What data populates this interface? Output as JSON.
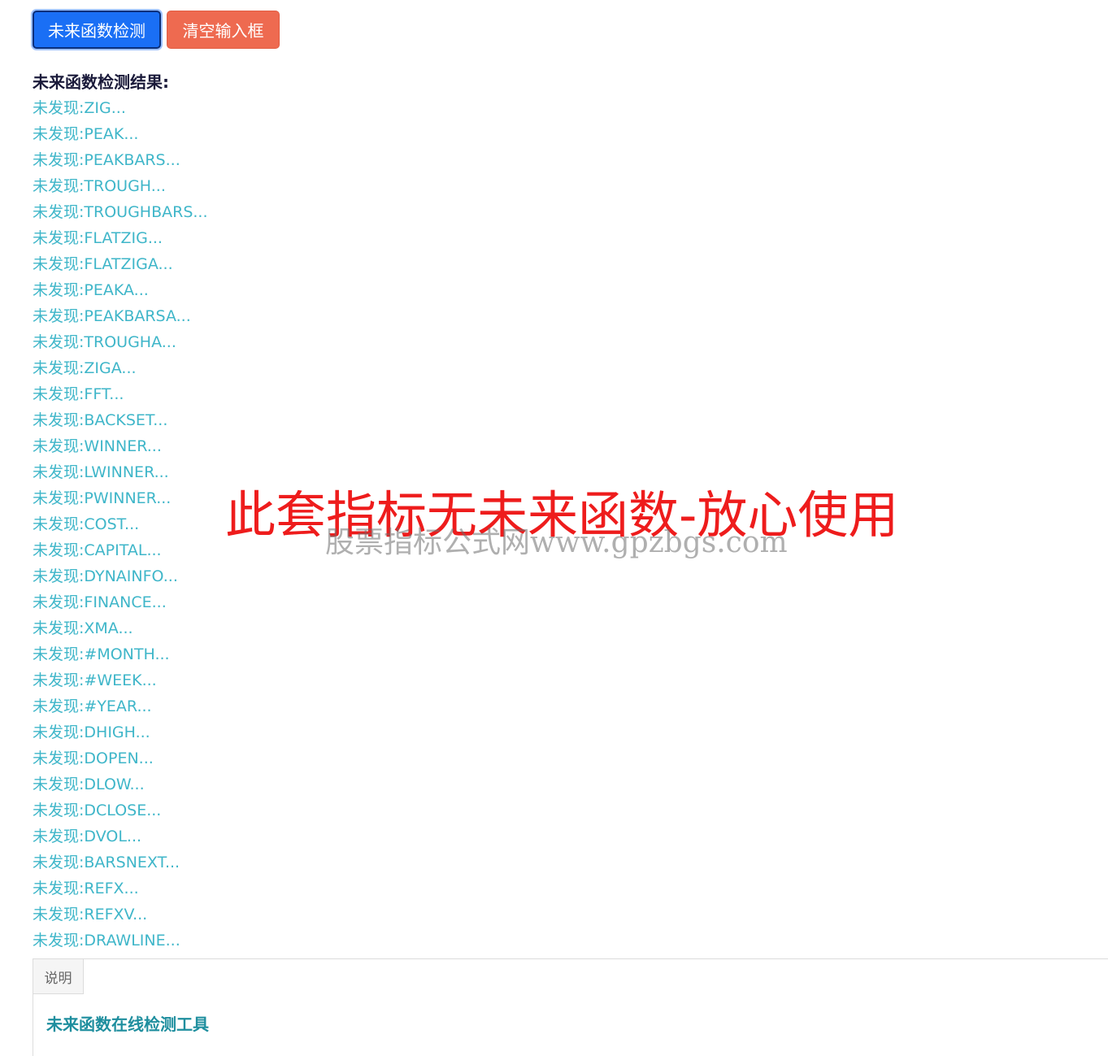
{
  "toolbar": {
    "detect_label": "未来函数检测",
    "clear_label": "清空输入框"
  },
  "results": {
    "title": "未来函数检测结果:",
    "items": [
      "未发现:ZIG...",
      "未发现:PEAK...",
      "未发现:PEAKBARS...",
      "未发现:TROUGH...",
      "未发现:TROUGHBARS...",
      "未发现:FLATZIG...",
      "未发现:FLATZIGA...",
      "未发现:PEAKA...",
      "未发现:PEAKBARSA...",
      "未发现:TROUGHA...",
      "未发现:ZIGA...",
      "未发现:FFT...",
      "未发现:BACKSET...",
      "未发现:WINNER...",
      "未发现:LWINNER...",
      "未发现:PWINNER...",
      "未发现:COST...",
      "未发现:CAPITAL...",
      "未发现:DYNAINFO...",
      "未发现:FINANCE...",
      "未发现:XMA...",
      "未发现:#MONTH...",
      "未发现:#WEEK...",
      "未发现:#YEAR...",
      "未发现:DHIGH...",
      "未发现:DOPEN...",
      "未发现:DLOW...",
      "未发现:DCLOSE...",
      "未发现:DVOL...",
      "未发现:BARSNEXT...",
      "未发现:REFX...",
      "未发现:REFXV...",
      "未发现:DRAWLINE..."
    ]
  },
  "overlay": {
    "headline": "此套指标无未来函数-放心使用",
    "watermark": "股票指标公式网www.gpzbgs.com"
  },
  "panel": {
    "tab_label": "说明",
    "heading": "未来函数在线检测工具"
  },
  "colors": {
    "primary_button": "#1a6ff5",
    "danger_button": "#ee6a50",
    "result_text": "#3fb6c9",
    "headline": "#ee1c1c",
    "panel_heading": "#1e8e9e"
  }
}
